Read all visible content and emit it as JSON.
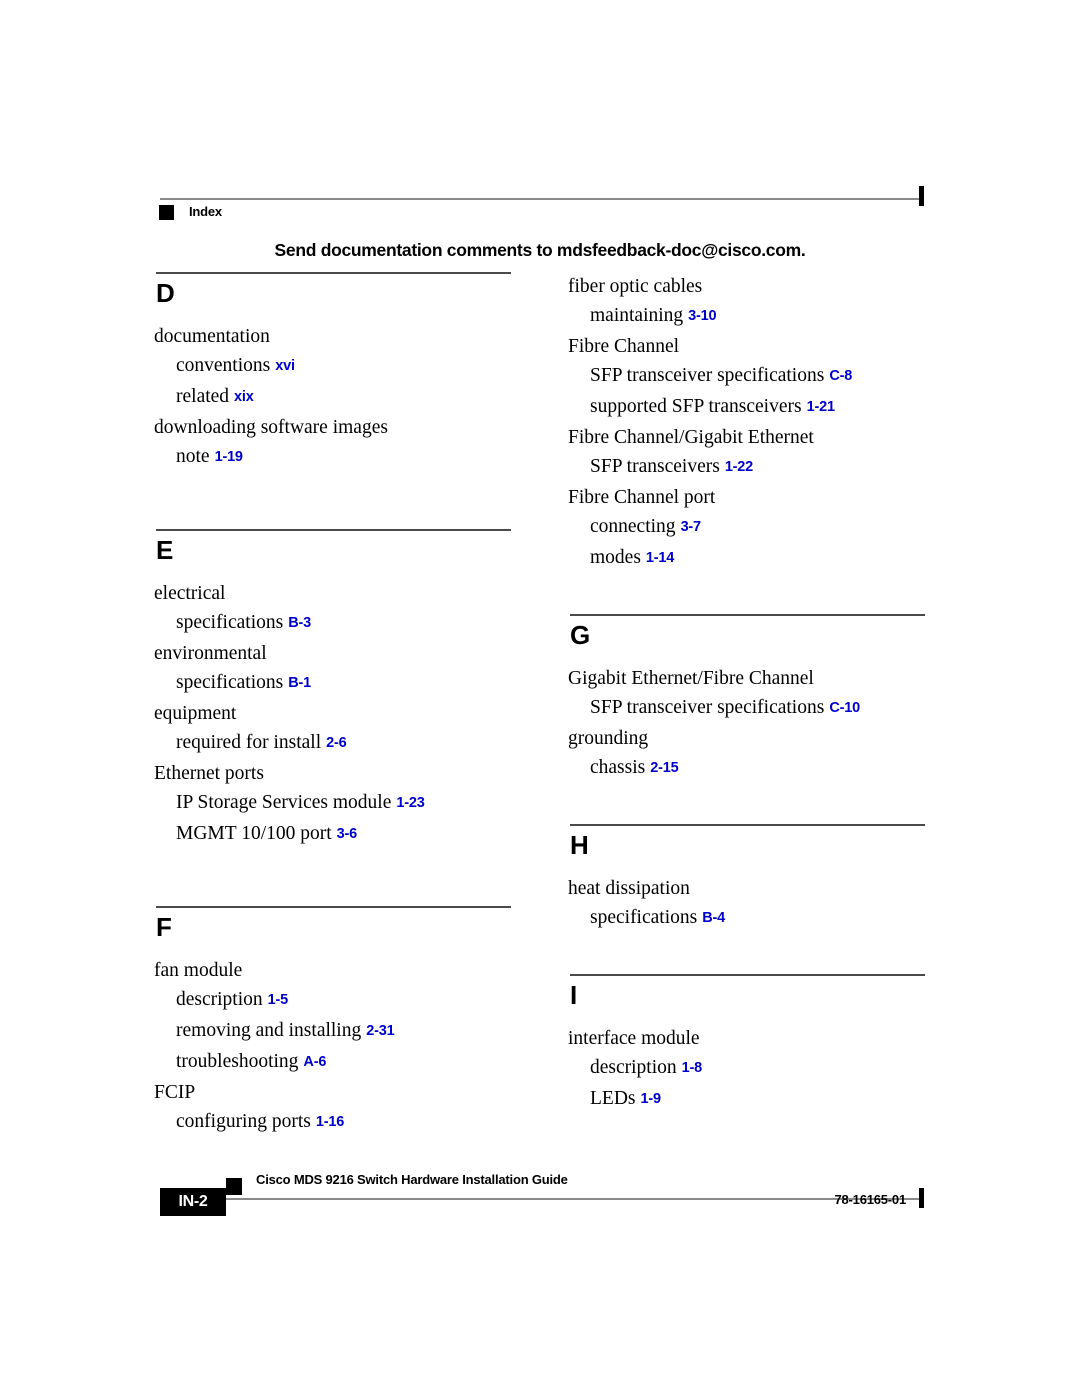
{
  "header": {
    "marker_icon": "black-square-icon",
    "running_head": "Index",
    "feedback_note": "Send documentation comments to mdsfeedback-doc@cisco.com."
  },
  "colors": {
    "page_reference_blue": "#0000CC",
    "rule_gray": "#8A8A8A",
    "text_black": "#000000"
  },
  "index": {
    "left_column": [
      {
        "letter": "D",
        "entries": [
          {
            "level": 1,
            "term": "documentation",
            "page": ""
          },
          {
            "level": 2,
            "term": "conventions",
            "page": "xvi"
          },
          {
            "level": 2,
            "term": "related",
            "page": "xix"
          },
          {
            "level": 1,
            "term": "downloading software images",
            "page": ""
          },
          {
            "level": 2,
            "term": "note",
            "page": "1-19"
          }
        ]
      },
      {
        "letter": "E",
        "entries": [
          {
            "level": 1,
            "term": "electrical",
            "page": ""
          },
          {
            "level": 2,
            "term": "specifications",
            "page": "B-3"
          },
          {
            "level": 1,
            "term": "environmental",
            "page": ""
          },
          {
            "level": 2,
            "term": "specifications",
            "page": "B-1"
          },
          {
            "level": 1,
            "term": "equipment",
            "page": ""
          },
          {
            "level": 2,
            "term": "required for install",
            "page": "2-6"
          },
          {
            "level": 1,
            "term": "Ethernet ports",
            "page": ""
          },
          {
            "level": 2,
            "term": "IP Storage Services module",
            "page": "1-23"
          },
          {
            "level": 2,
            "term": "MGMT 10/100 port",
            "page": "3-6"
          }
        ]
      },
      {
        "letter": "F",
        "entries": [
          {
            "level": 1,
            "term": "fan module",
            "page": ""
          },
          {
            "level": 2,
            "term": "description",
            "page": "1-5"
          },
          {
            "level": 2,
            "term": "removing and installing",
            "page": "2-31"
          },
          {
            "level": 2,
            "term": "troubleshooting",
            "page": "A-6"
          },
          {
            "level": 1,
            "term": "FCIP",
            "page": ""
          },
          {
            "level": 2,
            "term": "configuring ports",
            "page": "1-16"
          }
        ]
      }
    ],
    "right_column": [
      {
        "letter": "",
        "entries": [
          {
            "level": 1,
            "term": "fiber optic cables",
            "page": ""
          },
          {
            "level": 2,
            "term": "maintaining",
            "page": "3-10"
          },
          {
            "level": 1,
            "term": "Fibre Channel",
            "page": ""
          },
          {
            "level": 2,
            "term": "SFP transceiver specifications",
            "page": "C-8"
          },
          {
            "level": 2,
            "term": "supported SFP transceivers",
            "page": "1-21"
          },
          {
            "level": 1,
            "term": "Fibre Channel/Gigabit Ethernet",
            "page": ""
          },
          {
            "level": 2,
            "term": "SFP transceivers",
            "page": "1-22"
          },
          {
            "level": 1,
            "term": "Fibre Channel port",
            "page": ""
          },
          {
            "level": 2,
            "term": "connecting",
            "page": "3-7"
          },
          {
            "level": 2,
            "term": "modes",
            "page": "1-14"
          }
        ]
      },
      {
        "letter": "G",
        "entries": [
          {
            "level": 1,
            "term": "Gigabit Ethernet/Fibre Channel",
            "page": ""
          },
          {
            "level": 2,
            "term": "SFP transceiver specifications",
            "page": "C-10"
          },
          {
            "level": 1,
            "term": "grounding",
            "page": ""
          },
          {
            "level": 2,
            "term": "chassis",
            "page": "2-15"
          }
        ]
      },
      {
        "letter": "H",
        "entries": [
          {
            "level": 1,
            "term": "heat dissipation",
            "page": ""
          },
          {
            "level": 2,
            "term": "specifications",
            "page": "B-4"
          }
        ]
      },
      {
        "letter": "I",
        "entries": [
          {
            "level": 1,
            "term": "interface module",
            "page": ""
          },
          {
            "level": 2,
            "term": "description",
            "page": "1-8"
          },
          {
            "level": 2,
            "term": "LEDs",
            "page": "1-9"
          }
        ]
      }
    ]
  },
  "footer": {
    "page_number": "IN-2",
    "marker_icon": "black-square-icon",
    "guide_title": "Cisco MDS 9216 Switch Hardware Installation Guide",
    "document_number": "78-16165-01"
  }
}
